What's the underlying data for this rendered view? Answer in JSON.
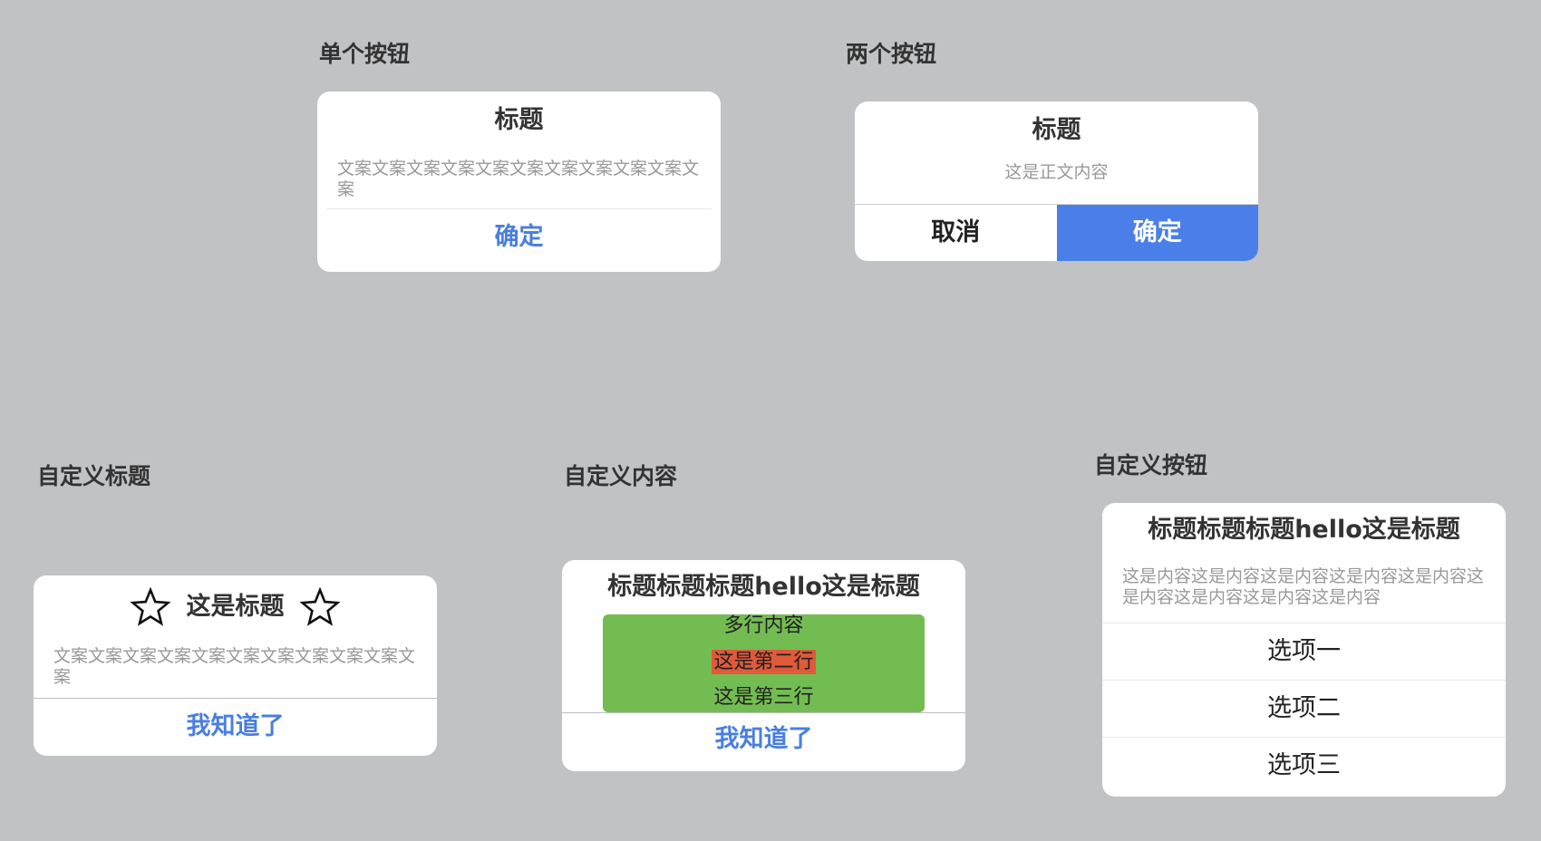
{
  "sections": {
    "single": {
      "label": "单个按钮",
      "title": "标题",
      "body": "文案文案文案文案文案文案文案文案文案文案文案",
      "button": "确定"
    },
    "double": {
      "label": "两个按钮",
      "title": "标题",
      "body": "这是正文内容",
      "cancel": "取消",
      "confirm": "确定",
      "confirm_color": "#4a7fe9"
    },
    "custom_title": {
      "label": "自定义标题",
      "title": "这是标题",
      "body": "文案文案文案文案文案文案文案文案文案文案文案",
      "button": "我知道了"
    },
    "custom_content": {
      "label": "自定义内容",
      "title": "标题标题标题hello这是标题",
      "lines": [
        "多行内容",
        "这是第二行",
        "这是第三行"
      ],
      "button": "我知道了",
      "box_color": "#73bc52",
      "highlight_color": "#e05a3a"
    },
    "custom_buttons": {
      "label": "自定义按钮",
      "title": "标题标题标题hello这是标题",
      "body": "这是内容这是内容这是内容这是内容这是内容这是内容这是内容这是内容这是内容",
      "options": [
        "选项一",
        "选项二",
        "选项三"
      ]
    }
  },
  "colors": {
    "background": "#c1c2c4",
    "link_blue": "#4a7fdf",
    "muted_text": "#999999"
  }
}
